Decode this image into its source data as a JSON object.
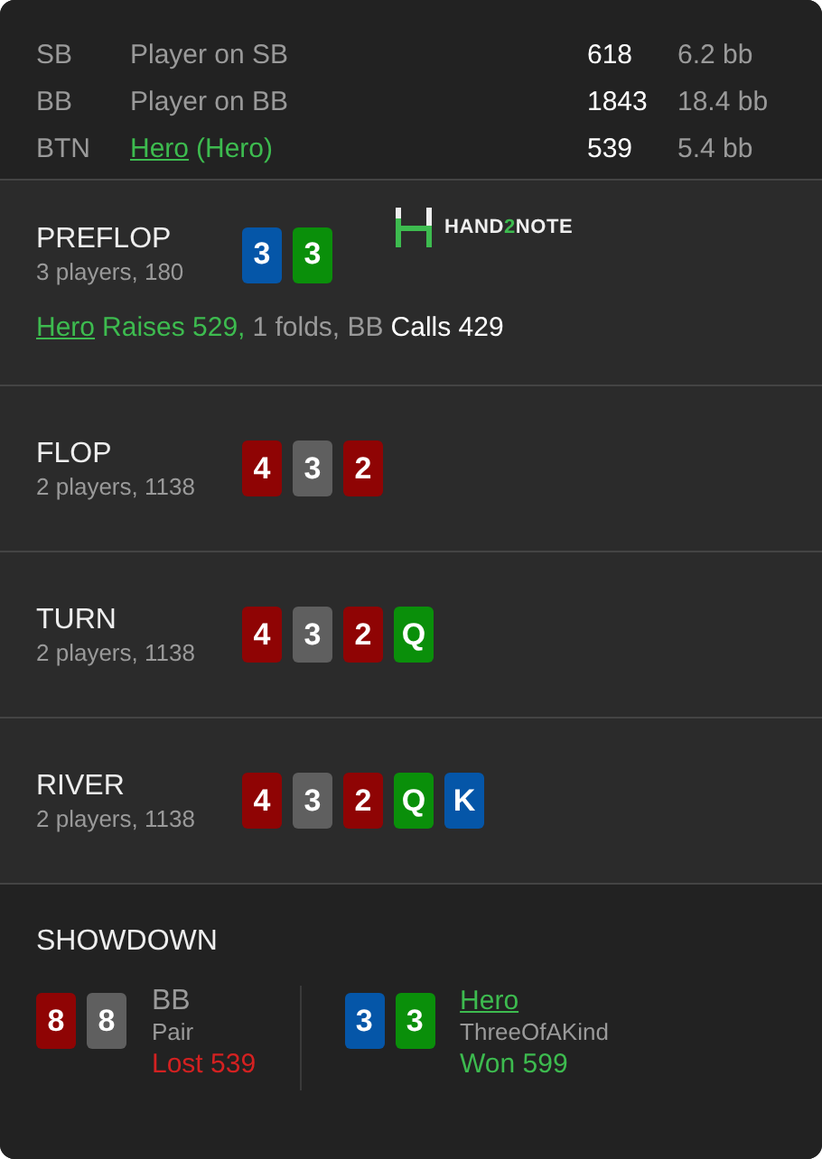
{
  "seats": [
    {
      "position": "SB",
      "name": "Player on SB",
      "is_hero": false,
      "stack": "618",
      "bb": "6.2 bb"
    },
    {
      "position": "BB",
      "name": "Player on BB",
      "is_hero": false,
      "stack": "1843",
      "bb": "18.4 bb"
    },
    {
      "position": "BTN",
      "name": "Hero",
      "tag": "(Hero)",
      "is_hero": true,
      "stack": "539",
      "bb": "5.4 bb"
    }
  ],
  "logo": {
    "parts": [
      {
        "text": "HAND",
        "accent": false
      },
      {
        "text": "2",
        "accent": true
      },
      {
        "text": "NOTE",
        "accent": false
      }
    ]
  },
  "streets": [
    {
      "name": "PREFLOP",
      "info": "3 players, 180",
      "cards": [
        {
          "rank": "3",
          "color": "#0556a8"
        },
        {
          "rank": "3",
          "color": "#0a8f0a"
        }
      ],
      "show_logo": true,
      "action": [
        {
          "kind": "player",
          "text": "Hero"
        },
        {
          "kind": "raise",
          "text": "Raises 529,"
        },
        {
          "kind": "plain",
          "text": "1 folds, BB"
        },
        {
          "kind": "call",
          "text": "Calls 429"
        }
      ]
    },
    {
      "name": "FLOP",
      "info": "2 players, 1138",
      "cards": [
        {
          "rank": "4",
          "color": "#8f0404"
        },
        {
          "rank": "3",
          "color": "#5f5f5f"
        },
        {
          "rank": "2",
          "color": "#8f0404"
        }
      ]
    },
    {
      "name": "TURN",
      "info": "2 players, 1138",
      "cards": [
        {
          "rank": "4",
          "color": "#8f0404"
        },
        {
          "rank": "3",
          "color": "#5f5f5f"
        },
        {
          "rank": "2",
          "color": "#8f0404"
        },
        {
          "rank": "Q",
          "color": "#0a8f0a"
        }
      ]
    },
    {
      "name": "RIVER",
      "info": "2 players, 1138",
      "cards": [
        {
          "rank": "4",
          "color": "#8f0404"
        },
        {
          "rank": "3",
          "color": "#5f5f5f"
        },
        {
          "rank": "2",
          "color": "#8f0404"
        },
        {
          "rank": "Q",
          "color": "#0a8f0a"
        },
        {
          "rank": "K",
          "color": "#0556a8"
        }
      ]
    }
  ],
  "showdown": {
    "title": "SHOWDOWN",
    "players": [
      {
        "cards": [
          {
            "rank": "8",
            "color": "#8f0404"
          },
          {
            "rank": "8",
            "color": "#5f5f5f"
          }
        ],
        "name": "BB",
        "is_hero": false,
        "hand": "Pair",
        "result": "Lost 539",
        "won": false
      },
      {
        "cards": [
          {
            "rank": "3",
            "color": "#0556a8"
          },
          {
            "rank": "3",
            "color": "#0a8f0a"
          }
        ],
        "name": "Hero",
        "is_hero": true,
        "hand": "ThreeOfAKind",
        "result": "Won 599",
        "won": true
      }
    ]
  }
}
